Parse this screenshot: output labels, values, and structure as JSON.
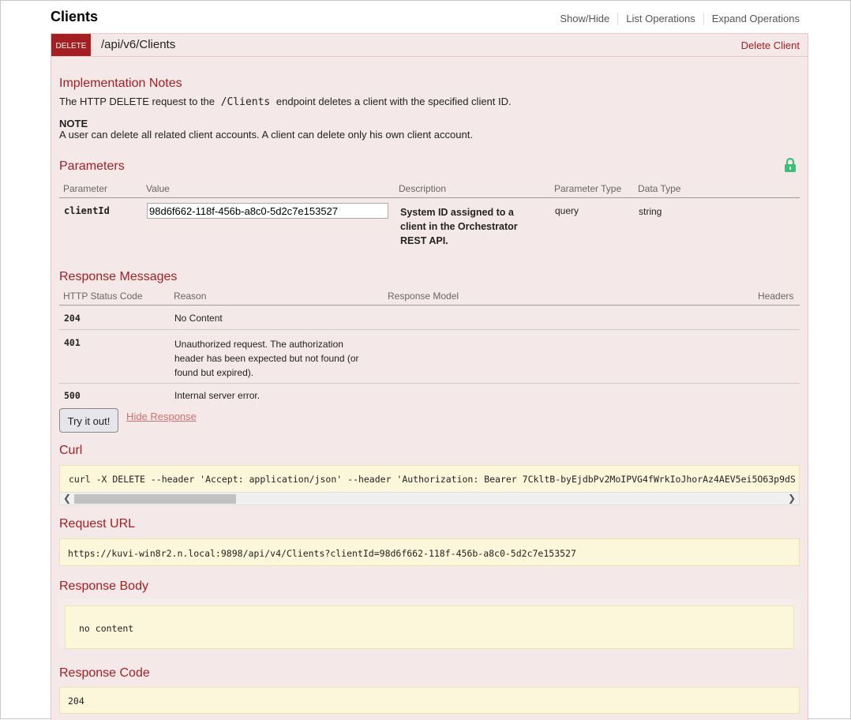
{
  "header": {
    "title": "Clients",
    "links": [
      "Show/Hide",
      "List Operations",
      "Expand Operations"
    ]
  },
  "operation": {
    "method": "DELETE",
    "path": "/api/v6/Clients",
    "summary": "Delete Client"
  },
  "implementation": {
    "heading": "Implementation Notes",
    "text_before": "The HTTP DELETE request to the",
    "code": "/Clients",
    "text_after": "endpoint deletes a client with the specified client ID.",
    "note_title": "NOTE",
    "note_text": "A user can delete all related client accounts. A client can delete only his own client account."
  },
  "parameters": {
    "heading": "Parameters",
    "columns": [
      "Parameter",
      "Value",
      "Description",
      "Parameter Type",
      "Data Type"
    ],
    "row": {
      "name": "clientId",
      "value": "98d6f662-118f-456b-a8c0-5d2c7e153527",
      "description_lines": [
        "System ID assigned to a",
        "client in the Orchestrator",
        "REST API."
      ],
      "param_type": "query",
      "data_type": "string"
    }
  },
  "responses": {
    "heading": "Response Messages",
    "columns": [
      "HTTP Status Code",
      "Reason",
      "Response Model",
      "Headers"
    ],
    "rows": [
      {
        "code": "204",
        "reason_lines": [
          "No Content"
        ]
      },
      {
        "code": "401",
        "reason_lines": [
          "Unauthorized request. The authorization",
          "header has been expected but not found (or",
          "found but expired)."
        ]
      },
      {
        "code": "500",
        "reason_lines": [
          "Internal server error."
        ]
      }
    ]
  },
  "actions": {
    "try_label": "Try it out!",
    "hide_label": "Hide Response"
  },
  "curl": {
    "heading": "Curl",
    "command": "curl -X DELETE --header 'Accept: application/json' --header 'Authorization: Bearer 7CkltB-byEjdbPv2MoIPVG4fWrkIoJhorAz4AEV5ei5O63p9dS"
  },
  "request_url": {
    "heading": "Request URL",
    "url": "https://kuvi-win8r2.n.local:9898/api/v4/Clients?clientId=98d6f662-118f-456b-a8c0-5d2c7e153527"
  },
  "response_body": {
    "heading": "Response Body",
    "content": "no content"
  },
  "response_code": {
    "heading": "Response Code",
    "code": "204"
  },
  "colors": {
    "accent": "#a41e22",
    "panel_bg": "#f5e8e8",
    "code_bg": "#fcf6db"
  },
  "icons": {
    "lock": "lock-icon"
  }
}
